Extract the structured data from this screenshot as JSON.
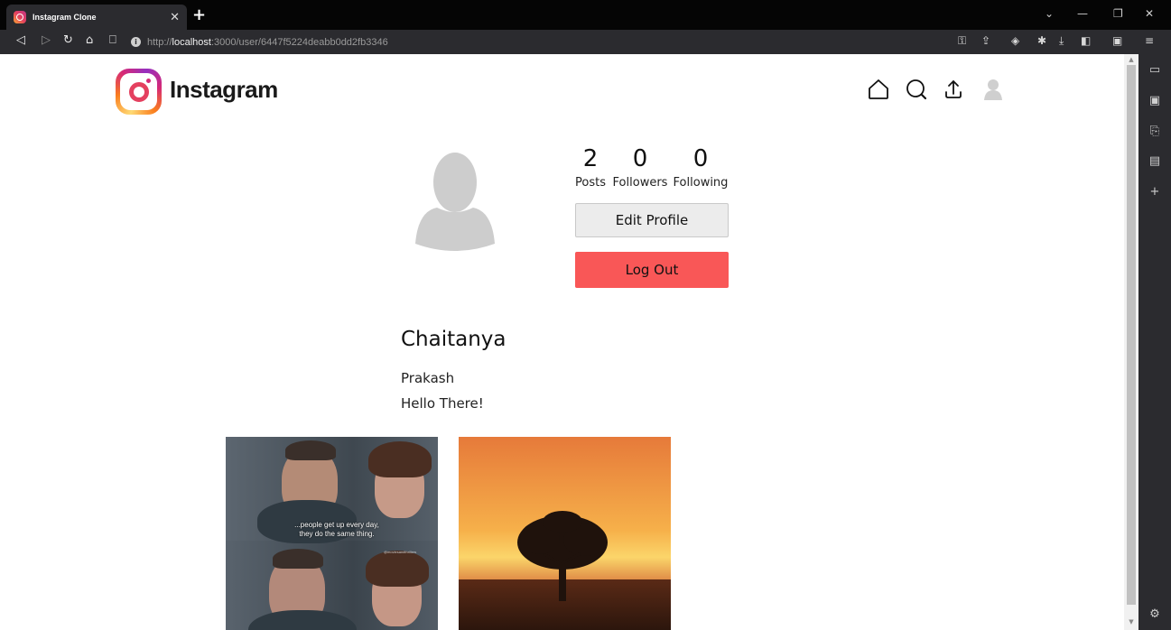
{
  "browser": {
    "tab_title": "Instagram Clone",
    "url_scheme": "http://",
    "url_host": "localhost",
    "url_path": ":3000/user/6447f5224deabb0dd2fb3346"
  },
  "header": {
    "brand": "Instagram",
    "nav_icons": [
      "home-icon",
      "search-icon",
      "upload-icon",
      "profile-icon"
    ]
  },
  "profile": {
    "stats": [
      {
        "value": "2",
        "label": "Posts"
      },
      {
        "value": "0",
        "label": "Followers"
      },
      {
        "value": "0",
        "label": "Following"
      }
    ],
    "edit_button": "Edit Profile",
    "logout_button": "Log Out",
    "username": "Chaitanya",
    "full_name": "Prakash",
    "bio": "Hello There!"
  },
  "posts": [
    {
      "caption": "...people get up every day, they do the same thing.",
      "watermark": "@moviesandthrillers"
    },
    {
      "caption": ""
    }
  ],
  "colors": {
    "logout_bg": "#f95757",
    "edit_bg": "#ececec",
    "titlebar": "#050505",
    "toolbar": "#2b2b2f"
  }
}
